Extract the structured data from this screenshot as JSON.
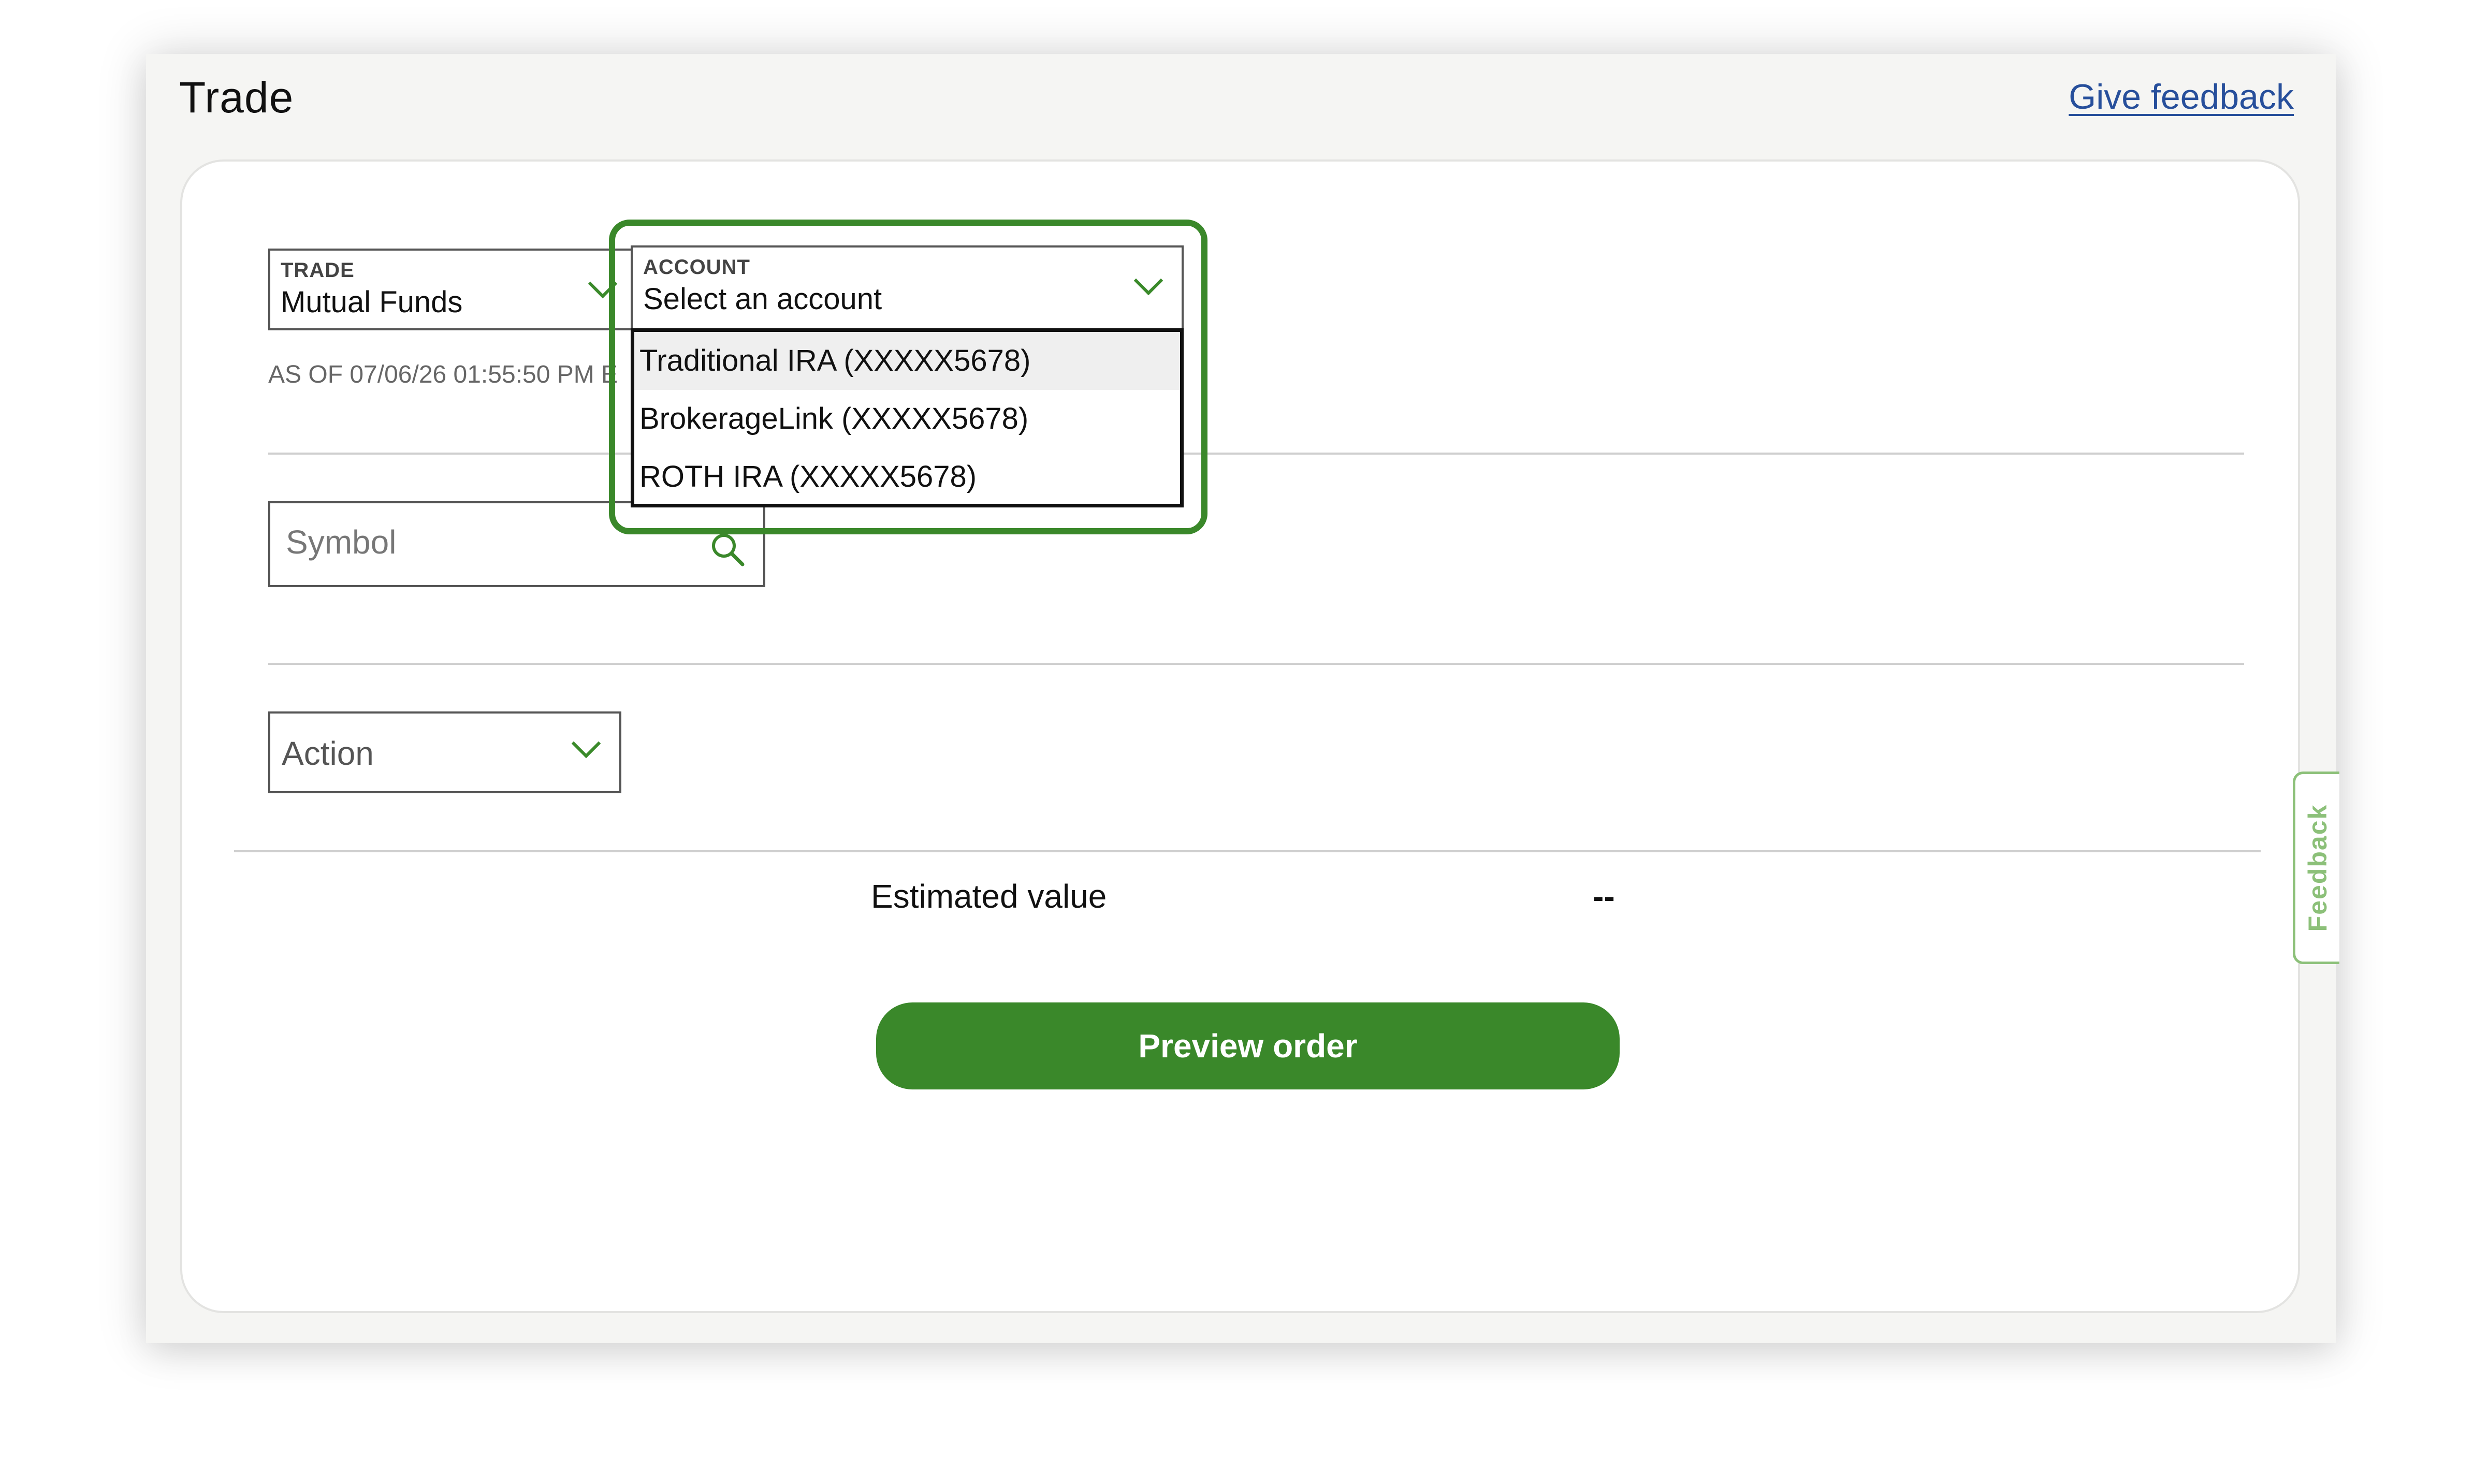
{
  "header": {
    "title": "Trade",
    "feedback_link": "Give feedback"
  },
  "trade_select": {
    "label": "TRADE",
    "value": "Mutual Funds"
  },
  "account_select": {
    "label": "ACCOUNT",
    "value": "Select an account",
    "options": [
      {
        "label": "Traditional IRA (XXXXX5678)",
        "highlighted": true
      },
      {
        "label": "BrokerageLink (XXXXX5678)",
        "highlighted": false
      },
      {
        "label": "ROTH IRA (XXXXX5678)",
        "highlighted": false
      }
    ]
  },
  "as_of": "AS OF 07/06/26 01:55:50 PM E",
  "symbol": {
    "placeholder": "Symbol"
  },
  "action": {
    "value": "Action"
  },
  "estimated": {
    "label": "Estimated value",
    "value": "--"
  },
  "preview_button": "Preview order",
  "feedback_tab": "Feedback",
  "colors": {
    "accent_green": "#3a882a",
    "link_blue": "#274f9b",
    "panel_bg": "#f5f5f3"
  },
  "icons": {
    "chevron": "chevron-down-icon",
    "search": "search-icon"
  }
}
